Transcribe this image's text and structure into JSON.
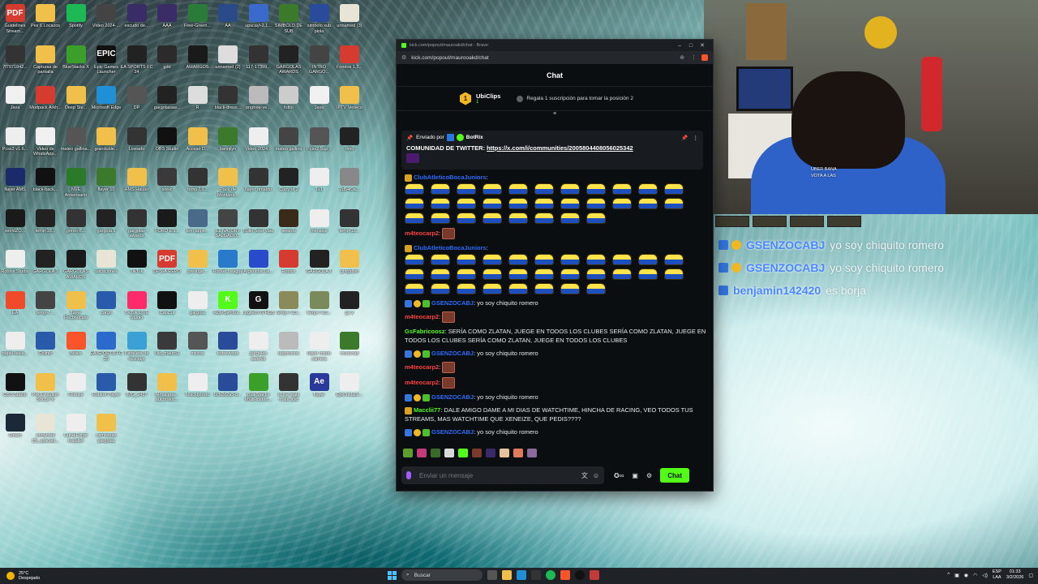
{
  "desktop": {
    "icons": [
      {
        "label": "Guidelines Stream...",
        "color": "#d63b2f",
        "glyph": "PDF"
      },
      {
        "label": "Pes 6 Locazos",
        "color": "#f0c04a",
        "glyph": ""
      },
      {
        "label": "Spotify",
        "color": "#1db954",
        "glyph": ""
      },
      {
        "label": "Video 2024-...",
        "color": "#444",
        "glyph": ""
      },
      {
        "label": "escudo de...",
        "color": "#3a2c66",
        "glyph": ""
      },
      {
        "label": "AAA",
        "color": "#3a2c66",
        "glyph": ""
      },
      {
        "label": "Free-Green...",
        "color": "#2a7a3a",
        "glyph": ""
      },
      {
        "label": "AA",
        "color": "#2a4a8a",
        "glyph": ""
      },
      {
        "label": "upscayl-2.1...",
        "color": "#3a6acc",
        "glyph": ""
      },
      {
        "label": "SIMBOLO DE SUB",
        "color": "#3a7a2a",
        "glyph": ""
      },
      {
        "label": "simbolo sub piola",
        "color": "#2a4a9a",
        "glyph": ""
      },
      {
        "label": "unnamed (3)",
        "color": "#e8e4d6",
        "glyph": ""
      },
      {
        "label": "7f7971842...",
        "color": "#333",
        "glyph": ""
      },
      {
        "label": "Capturas de pantalla",
        "color": "#f0c04a",
        "glyph": ""
      },
      {
        "label": "BlueStacks X",
        "color": "#3aa02a",
        "glyph": ""
      },
      {
        "label": "Epic Games Launcher",
        "color": "#111",
        "glyph": "EPIC"
      },
      {
        "label": "EA SPORTS FC 24",
        "color": "#222",
        "glyph": ""
      },
      {
        "label": "gdd",
        "color": "#2b2b2b",
        "glyph": ""
      },
      {
        "label": "AMARGOS",
        "color": "#1a1a1a",
        "glyph": ""
      },
      {
        "label": "unnamed (2)",
        "color": "#ddd",
        "glyph": ""
      },
      {
        "label": "117-17399...",
        "color": "#333",
        "glyph": ""
      },
      {
        "label": "GARGOLAS AWARDS",
        "color": "#222",
        "glyph": ""
      },
      {
        "label": "INTRO GARGO...",
        "color": "#444",
        "glyph": ""
      },
      {
        "label": "Fondos 1.3...",
        "color": "#d63b2f",
        "glyph": ""
      },
      {
        "label": "Java",
        "color": "#f0f0f0",
        "glyph": ""
      },
      {
        "label": "Modpack Arkh...",
        "color": "#d63b2f",
        "glyph": ""
      },
      {
        "label": "Deep Sle...",
        "color": "#f0c04a",
        "glyph": ""
      },
      {
        "label": "Microsoft Edge",
        "color": "#1f8fd6",
        "glyph": ""
      },
      {
        "label": "DP",
        "color": "#555",
        "glyph": ""
      },
      {
        "label": "gargolasaw...",
        "color": "#222",
        "glyph": ""
      },
      {
        "label": "R",
        "color": "#ddd",
        "glyph": ""
      },
      {
        "label": "black-dress...",
        "color": "#333",
        "glyph": ""
      },
      {
        "label": "pngtree-ve...",
        "color": "#bbb",
        "glyph": ""
      },
      {
        "label": "fotito",
        "color": "#ccc",
        "glyph": ""
      },
      {
        "label": "Java",
        "color": "#f0f0f0",
        "glyph": ""
      },
      {
        "label": "IPTV Veneco",
        "color": "#f0c04a",
        "glyph": ""
      },
      {
        "label": "Pcsx2 v1.6...",
        "color": "#eee",
        "glyph": ""
      },
      {
        "label": "Video de WhatsApp...",
        "color": "#f0f0f0",
        "glyph": ""
      },
      {
        "label": "mateo gallina...",
        "color": "#555",
        "glyph": ""
      },
      {
        "label": "granduble...",
        "color": "#f0c04a",
        "glyph": ""
      },
      {
        "label": "Liseado",
        "color": "#333",
        "glyph": ""
      },
      {
        "label": "OBS Studio",
        "color": "#111",
        "glyph": ""
      },
      {
        "label": "Acceso D...",
        "color": "#f0c04a",
        "glyph": ""
      },
      {
        "label": "bannilyn",
        "color": "#3a7a2a",
        "glyph": ""
      },
      {
        "label": "Video 2024...",
        "color": "#eee",
        "glyph": ""
      },
      {
        "label": "mateo gallina",
        "color": "#444",
        "glyph": ""
      },
      {
        "label": "Pcsx2 Sup...",
        "color": "#555",
        "glyph": ""
      },
      {
        "label": "rlmo",
        "color": "#222",
        "glyph": ""
      },
      {
        "label": "flayer AMS",
        "color": "#1a2a6a",
        "glyph": ""
      },
      {
        "label": "black-back...",
        "color": "#111",
        "glyph": ""
      },
      {
        "label": "NVE Aniversario",
        "color": "#2a7a2a",
        "glyph": ""
      },
      {
        "label": "flayer 10",
        "color": "#3a7a2a",
        "glyph": ""
      },
      {
        "label": "HMS Hauler",
        "color": "#f0c04a",
        "glyph": ""
      },
      {
        "label": "sonic",
        "color": "#3a3a3a",
        "glyph": ""
      },
      {
        "label": "temp-18...",
        "color": "#333",
        "glyph": ""
      },
      {
        "label": "Pack de Montana...",
        "color": "#f0c04a",
        "glyph": ""
      },
      {
        "label": "flayer rimaldo",
        "color": "#333",
        "glyph": ""
      },
      {
        "label": "Copy of 2",
        "color": "#222",
        "glyph": ""
      },
      {
        "label": "1v1",
        "color": "#eee",
        "glyph": ""
      },
      {
        "label": "2d54f0a...",
        "color": "#888",
        "glyph": ""
      },
      {
        "label": "worldZO...",
        "color": "#1a1a1a",
        "glyph": ""
      },
      {
        "label": "temp-18...",
        "color": "#222",
        "glyph": ""
      },
      {
        "label": "gordo-8...",
        "color": "#333",
        "glyph": ""
      },
      {
        "label": "gargola 1",
        "color": "#222",
        "glyph": ""
      },
      {
        "label": "gargolas awards",
        "color": "#333",
        "glyph": ""
      },
      {
        "label": "FORO EN...",
        "color": "#1a1a1a",
        "glyph": ""
      },
      {
        "label": "tom apps...",
        "color": "#4a6a8a",
        "glyph": ""
      },
      {
        "label": "EL NATORY SALGADO...",
        "color": "#444",
        "glyph": ""
      },
      {
        "label": "Bolin Soul Vaal",
        "color": "#333",
        "glyph": ""
      },
      {
        "label": "awards",
        "color": "#3a2a1a",
        "glyph": ""
      },
      {
        "label": "mensaje",
        "color": "#eee",
        "glyph": ""
      },
      {
        "label": "temp-18...",
        "color": "#333",
        "glyph": ""
      },
      {
        "label": "Roblox Studio",
        "color": "#eee",
        "glyph": ""
      },
      {
        "label": "GARGOLA 1",
        "color": "#222",
        "glyph": ""
      },
      {
        "label": "GARGOLAS AWARDS",
        "color": "#1a1a1a",
        "glyph": ""
      },
      {
        "label": "vacaciones",
        "color": "#e8e4d6",
        "glyph": ""
      },
      {
        "label": "TikTok",
        "color": "#111",
        "glyph": ""
      },
      {
        "label": "DPS-A REPO",
        "color": "#d63b2f",
        "glyph": "PDF"
      },
      {
        "label": "prestige...",
        "color": "#f0c04a",
        "glyph": ""
      },
      {
        "label": "Rocket League",
        "color": "#2a7acc",
        "glyph": ""
      },
      {
        "label": "Argentina Lik...",
        "color": "#2a4acc",
        "glyph": ""
      },
      {
        "label": "Roblox",
        "color": "#d63b2f",
        "glyph": ""
      },
      {
        "label": "GARGOLA 1",
        "color": "#222",
        "glyph": ""
      },
      {
        "label": "ghvgdfsn",
        "color": "#f0c04a",
        "glyph": ""
      },
      {
        "label": "EA",
        "color": "#f04a2a",
        "glyph": ""
      },
      {
        "label": "temp-7...",
        "color": "#444",
        "glyph": ""
      },
      {
        "label": "flayer Reconocido",
        "color": "#f0c04a",
        "glyph": ""
      },
      {
        "label": "cargo",
        "color": "#2a5aaa",
        "glyph": ""
      },
      {
        "label": "TikTok LIVE Studio",
        "color": "#ff2a6a",
        "glyph": ""
      },
      {
        "label": "CapCut",
        "color": "#111",
        "glyph": ""
      },
      {
        "label": "gargola",
        "color": "#eee",
        "glyph": ""
      },
      {
        "label": "Kick-Symbol...",
        "color": "#53fc18",
        "glyph": "K"
      },
      {
        "label": "Logitech G HUB",
        "color": "#111",
        "glyph": "G"
      },
      {
        "label": "temp-7-23...",
        "color": "#8a8a5a",
        "glyph": ""
      },
      {
        "label": "temp-7-23...",
        "color": "#7a8a5a",
        "glyph": ""
      },
      {
        "label": "gx 2",
        "color": "#222",
        "glyph": ""
      },
      {
        "label": "papel-tesla...",
        "color": "#eee",
        "glyph": ""
      },
      {
        "label": "Chlinfo",
        "color": "#2a5aaa",
        "glyph": ""
      },
      {
        "label": "Brave",
        "color": "#fb542b",
        "glyph": ""
      },
      {
        "label": "EA SPORTS FC 25",
        "color": "#2a6acc",
        "glyph": ""
      },
      {
        "label": "Papelera de reciclaje",
        "color": "#3aa0d6",
        "glyph": ""
      },
      {
        "label": "clip_mauro3",
        "color": "#3a3a3a",
        "glyph": ""
      },
      {
        "label": "micros",
        "color": "#555",
        "glyph": ""
      },
      {
        "label": "entrevistas",
        "color": "#2a4a9a",
        "glyph": ""
      },
      {
        "label": "gargolas awards",
        "color": "#eee",
        "glyph": ""
      },
      {
        "label": "deportinos",
        "color": "#bbb",
        "glyph": ""
      },
      {
        "label": "flayer modo camera",
        "color": "#eee",
        "glyph": ""
      },
      {
        "label": "minecraft",
        "color": "#3a7a2a",
        "glyph": ""
      },
      {
        "label": "OBS Studio",
        "color": "#111",
        "glyph": ""
      },
      {
        "label": "Pro Evolution Soccer 6",
        "color": "#f0c04a",
        "glyph": ""
      },
      {
        "label": "Fortnite",
        "color": "#eee",
        "glyph": ""
      },
      {
        "label": "Roblox Player",
        "color": "#2a5aaa",
        "glyph": ""
      },
      {
        "label": "IMG_2417",
        "color": "#333",
        "glyph": ""
      },
      {
        "label": "Almacena... automatic...",
        "color": "#f0c04a",
        "glyph": ""
      },
      {
        "label": "lolscktphoto",
        "color": "#eee",
        "glyph": ""
      },
      {
        "label": "bcb2d2a5-8...",
        "color": "#2a4a9a",
        "glyph": ""
      },
      {
        "label": "BlueStacks Multi-Instan...",
        "color": "#3aa02a",
        "glyph": ""
      },
      {
        "label": "el the stats mate.abd",
        "color": "#333",
        "glyph": ""
      },
      {
        "label": "flayer",
        "color": "#2a3a9a",
        "glyph": "Ae"
      },
      {
        "label": "EpicInstalle...",
        "color": "#eee",
        "glyph": ""
      },
      {
        "label": "Steam",
        "color": "#1b2838",
        "glyph": ""
      },
      {
        "label": "unnamed (3)_upscayl...",
        "color": "#e8e4d6",
        "glyph": ""
      },
      {
        "label": "CurseForge Installer",
        "color": "#eee",
        "glyph": ""
      },
      {
        "label": "camisetas gargolas",
        "color": "#f0c04a",
        "glyph": ""
      }
    ]
  },
  "browser": {
    "title": "kick.com/popout/mauroakd/chat - Brave",
    "url": "kick.com/popout/maurooakd/chat"
  },
  "chat": {
    "header": "Chat",
    "leaderboard": {
      "rank": "1",
      "user": "UbiClips",
      "count": "1",
      "promo": "Regala 1 suscripción para tomar la posición 2"
    },
    "pinned": {
      "sent_by_label": "Enviado por",
      "sender": "BotRix",
      "text_prefix": "COMUNIDAD DE TWITTER:",
      "link": "https://x.com/i/communities/2005804408056025342"
    },
    "messages": [
      {
        "user": "ClubAtleticoBocaJuniors",
        "color": "#2b6cff",
        "text": "",
        "minions": 30
      },
      {
        "user": "m4teocarp2",
        "color": "#ff4040",
        "text": "",
        "face": true
      },
      {
        "user": "ClubAtleticoBocaJuniors",
        "color": "#2b6cff",
        "text": "",
        "minions": 30
      },
      {
        "user": "GSENZOCABJ",
        "color": "#2b6cff",
        "text": "yo soy chiquito romero"
      },
      {
        "user": "m4teocarp2",
        "color": "#ff4040",
        "text": "",
        "face": true
      },
      {
        "user": "GsFabricoosz",
        "color": "#53fc18",
        "text": "SERÍA COMO ZLATAN, JUEGE EN TODOS LOS CLUBES SERÍA COMO ZLATAN, JUEGE EN TODOS LOS CLUBES SERÍA COMO ZLATAN, JUEGE EN TODOS LOS CLUBES"
      },
      {
        "user": "GSENZOCABJ",
        "color": "#2b6cff",
        "text": "yo soy chiquito romero"
      },
      {
        "user": "m4teocarp2",
        "color": "#ff4040",
        "text": "",
        "face": true
      },
      {
        "user": "m4teocarp2",
        "color": "#ff4040",
        "text": "",
        "face": true
      },
      {
        "user": "GSENZOCABJ",
        "color": "#2b6cff",
        "text": "yo soy chiquito romero"
      },
      {
        "user": "Macclii77",
        "color": "#53fc18",
        "text": "DALE AMIGO DAME A MI DIAS DE WATCHTIME, HINCHA DE RACING, VEO TODOS TUS STREAMS, MAS WATCHTIME QUE XENEIZE, QUE PEDIS????"
      },
      {
        "user": "GSENZOCABJ",
        "color": "#2b6cff",
        "text": "yo soy chiquito romero"
      }
    ],
    "input_placeholder": "Enviar un mensaje",
    "send_button": "Chat"
  },
  "webcam_overlay": {
    "line1": "UBER BANA",
    "line2": "VOTA A LAS"
  },
  "stream_overlay": {
    "messages": [
      {
        "user": "GSENZOCABJ",
        "text": "yo soy chiquito romero"
      },
      {
        "user": "GSENZOCABJ",
        "text": "yo soy chiquito romero"
      },
      {
        "user": "benjamin142420",
        "text": "es borja"
      }
    ]
  },
  "taskbar": {
    "weather_temp": "25°C",
    "weather_desc": "Despejado",
    "search_label": "Buscar",
    "lang_top": "ESP",
    "lang_bottom": "LAA",
    "time": "01:33",
    "date": "3/2/2026"
  }
}
